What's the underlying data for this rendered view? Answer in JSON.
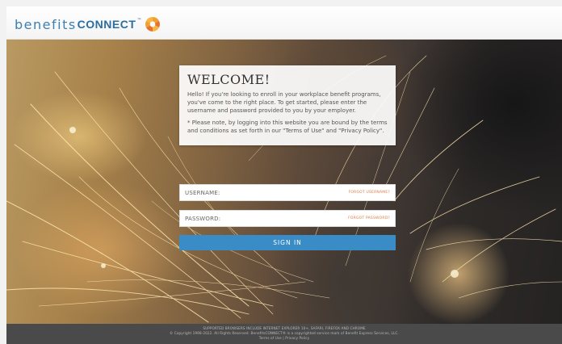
{
  "header": {
    "logo_benefits": "benefits",
    "logo_connect": "CONNECT",
    "logo_tm": "™"
  },
  "welcome": {
    "title": "WELCOME!",
    "intro": "Hello! If you're looking to enroll in your workplace benefit programs, you've come to the right place. To get started, please enter the username and password provided to you by your employer.",
    "note": "* Please note, by logging into this website you are bound by the terms and conditions as set forth in our \"Terms of Use\" and \"Privacy Policy\"."
  },
  "login": {
    "username_label": "USERNAME:",
    "username_value": "",
    "forgot_username": "FORGOT USERNAME?",
    "password_label": "PASSWORD:",
    "password_value": "",
    "forgot_password": "FORGOT PASSWORD?",
    "signin_label": "SIGN IN",
    "signin_color": "#3a8cc6"
  },
  "footer": {
    "browsers": "SUPPORTED BROWSERS INCLUDE INTERNET EXPLORER 10+, SAFARI, FIREFOX AND CHROME",
    "copyright": "© Copyright 1998-2022. All Rights Reserved. BenefitsCONNECT® is a copyrighted service mark of Benefit Express Services, LLC.",
    "terms": "Terms of Use",
    "separator": "|",
    "privacy": "Privacy Policy"
  },
  "colors": {
    "brand_blue": "#2b6ea0",
    "accent_orange": "#e07a40",
    "footer_bg": "#4a4a4a"
  }
}
